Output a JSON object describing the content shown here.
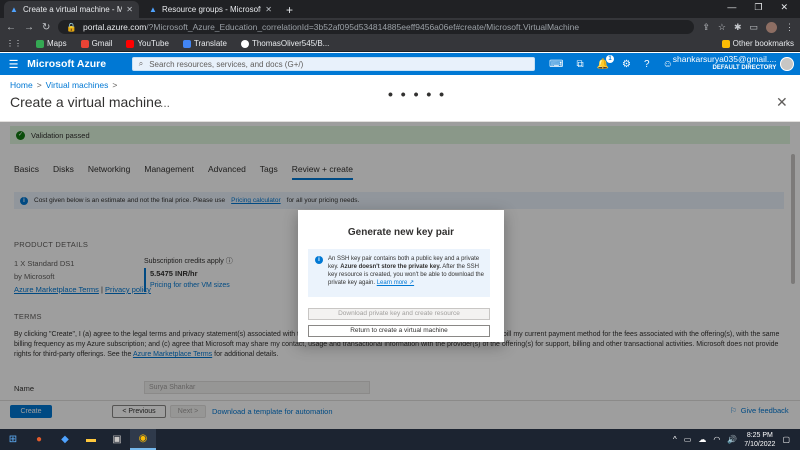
{
  "browser": {
    "tabs": [
      {
        "title": "Create a virtual machine - Micros",
        "close": "✕"
      },
      {
        "title": "Resource groups - Microsoft Azu",
        "close": "✕"
      }
    ],
    "new_tab": "+",
    "url_domain": "portal.azure.com",
    "url_rest": "/?Microsoft_Azure_Education_correlationId=3b52af095d534814885eeff9456a06ef#create/Microsoft.VirtualMachine",
    "bookmarks": [
      {
        "label": "Maps",
        "color": "#34a853"
      },
      {
        "label": "Gmail",
        "color": "#ea4335"
      },
      {
        "label": "YouTube",
        "color": "#ff0000"
      },
      {
        "label": "Translate",
        "color": "#4285f4"
      },
      {
        "label": "ThomasOliver545/B...",
        "color": "#ffffff"
      }
    ],
    "other_bookmarks": "Other bookmarks"
  },
  "azure": {
    "brand": "Microsoft Azure",
    "search_placeholder": "Search resources, services, and docs (G+/)",
    "notification_count": "1",
    "user_email": "shankarsurya035@gmail....",
    "user_directory": "DEFAULT DIRECTORY"
  },
  "page": {
    "breadcrumb": [
      "Home",
      "Virtual machines"
    ],
    "breadcrumb_sep": ">",
    "title": "Create a virtual machine",
    "ellipsis": "...",
    "loading": "• • • • •",
    "close": "✕"
  },
  "content": {
    "validation": "Validation passed",
    "tabs": [
      "Basics",
      "Disks",
      "Networking",
      "Management",
      "Advanced",
      "Tags",
      "Review + create"
    ],
    "active_tab": "Review + create",
    "info_text": "Cost given below is an estimate and not the final price. Please use",
    "info_link": "Pricing calculator",
    "info_tail": "for all your pricing needs.",
    "product_details_heading": "PRODUCT DETAILS",
    "product_name": "1 X Standard DS1",
    "product_by": "by Microsoft",
    "terms_link": "Azure Marketplace Terms",
    "privacy_link": "Privacy policy",
    "link_sep": "|",
    "credits_label": "Subscription credits apply",
    "price": "5.5475 INR/hr",
    "pricing_other": "Pricing for other VM sizes",
    "terms_heading": "TERMS",
    "terms_text": "By clicking \"Create\", I (a) agree to the legal terms and privacy statement(s) associated with the Marketplace offering(s) listed above; (b) authorize Microsoft to bill my current payment method for the fees associated with the offering(s), with the same billing frequency as my Azure subscription; and (c) agree that Microsoft may share my contact, usage and transactional information with the provider(s) of the offering(s) for support, billing and other transactional activities. Microsoft does not provide rights for third-party offerings. See the",
    "terms_tail": "for additional details.",
    "name_label": "Name",
    "name_value": "Surya Shankar"
  },
  "footer": {
    "create": "Create",
    "previous": "< Previous",
    "next": "Next >",
    "download_template": "Download a template for automation",
    "feedback": "Give feedback"
  },
  "dialog": {
    "title": "Generate new key pair",
    "info_a": "An SSH key pair contains both a public key and a private key.",
    "info_bold": "Azure doesn't store the private key.",
    "info_b": "After the SSH key resource is created, you won't be able to download the private key again.",
    "learn_more": "Learn more ↗",
    "btn_download": "Download private key and create resource",
    "btn_return": "Return to create a virtual machine"
  },
  "taskbar": {
    "time": "8:25 PM",
    "date": "7/10/2022"
  }
}
